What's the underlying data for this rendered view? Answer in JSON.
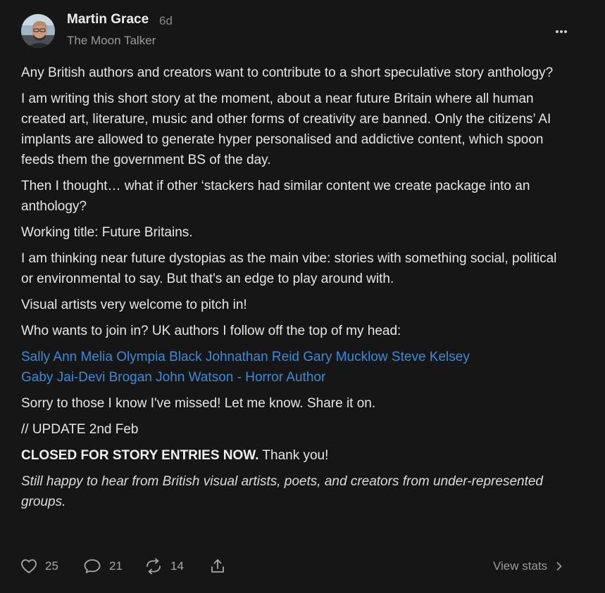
{
  "author": {
    "name": "Martin Grace",
    "time_ago": "6d",
    "publication": "The Moon Talker"
  },
  "body": {
    "p1": "Any British authors and creators want to contribute to a short speculative story anthology?",
    "p2": "I am writing this short story at the moment, about a near future Britain where all human created art, literature, music and other forms of creativity are banned. Only the citizens’ AI implants are allowed to generate hyper personalised and addictive content, which spoon feeds them the government BS of the day.",
    "p3": "Then I thought… what if other ‘stackers had similar content we create package into an anthology?",
    "p4": "Working title: Future Britains.",
    "p5": "I am thinking near future dystopias as the main vibe: stories with something social, political or environmental to say. But that's an edge to play around with.",
    "p6": "Visual artists very welcome to pitch in!",
    "p7": "Who wants to join in? UK authors I follow off the top of my head:",
    "mentions": [
      "Sally Ann Melia",
      "Olympia Black",
      "Johnathan Reid",
      "Gary Mucklow",
      "Steve Kelsey",
      "Gaby Jai-Devi Brogan",
      "John Watson - Horror Author"
    ],
    "p8": "Sorry to those I know I've missed! Let me know. Share it on.",
    "p9": "// UPDATE 2nd Feb",
    "p10_bold": "CLOSED FOR STORY ENTRIES NOW.",
    "p10_rest": " Thank you!",
    "p11": "Still happy to hear from British visual artists, poets, and creators from under-represented groups."
  },
  "actions": {
    "likes": "25",
    "comments": "21",
    "restacks": "14",
    "view_stats": "View stats"
  },
  "icons": {
    "like": "heart-icon",
    "comment": "comment-bubble-icon",
    "restack": "restack-arrows-icon",
    "share": "share-upload-icon",
    "more": "more-dots-icon",
    "view_stats": "chevron-right-icon"
  },
  "colors": {
    "background": "#161616",
    "text": "#e6e6e6",
    "muted": "#9a9a9a",
    "link": "#3a8bd6"
  }
}
